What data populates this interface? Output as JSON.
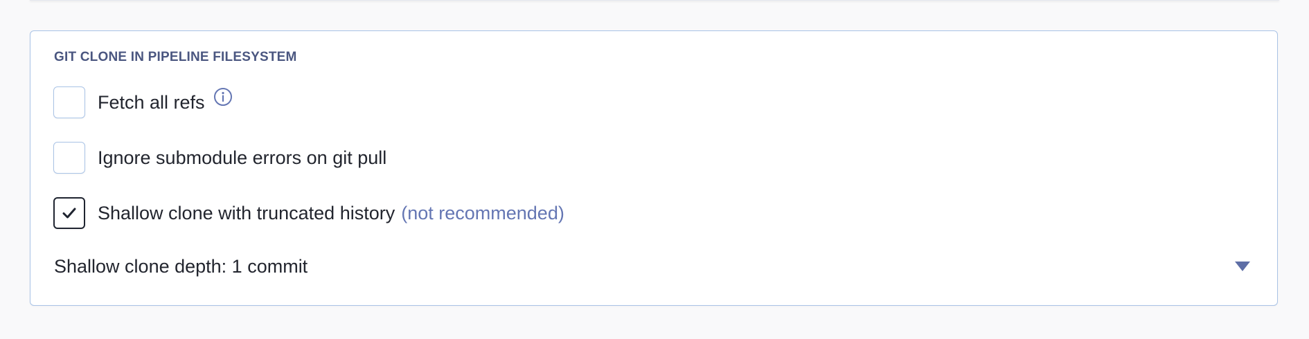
{
  "section": {
    "title": "GIT CLONE IN PIPELINE FILESYSTEM"
  },
  "options": [
    {
      "label": "Fetch all refs",
      "checked": false,
      "icon": "info-icon"
    },
    {
      "label": "Ignore submodule errors on git pull",
      "checked": false
    },
    {
      "label": "Shallow clone with truncated history",
      "hint": "(not recommended)",
      "checked": true
    }
  ],
  "depth": {
    "label": "Shallow clone depth: 1 commit",
    "icon": "chevron-down-icon"
  },
  "colors": {
    "accent": "#6476b3",
    "border": "#a9c3e6",
    "title": "#4a5680",
    "text": "#22252e"
  }
}
